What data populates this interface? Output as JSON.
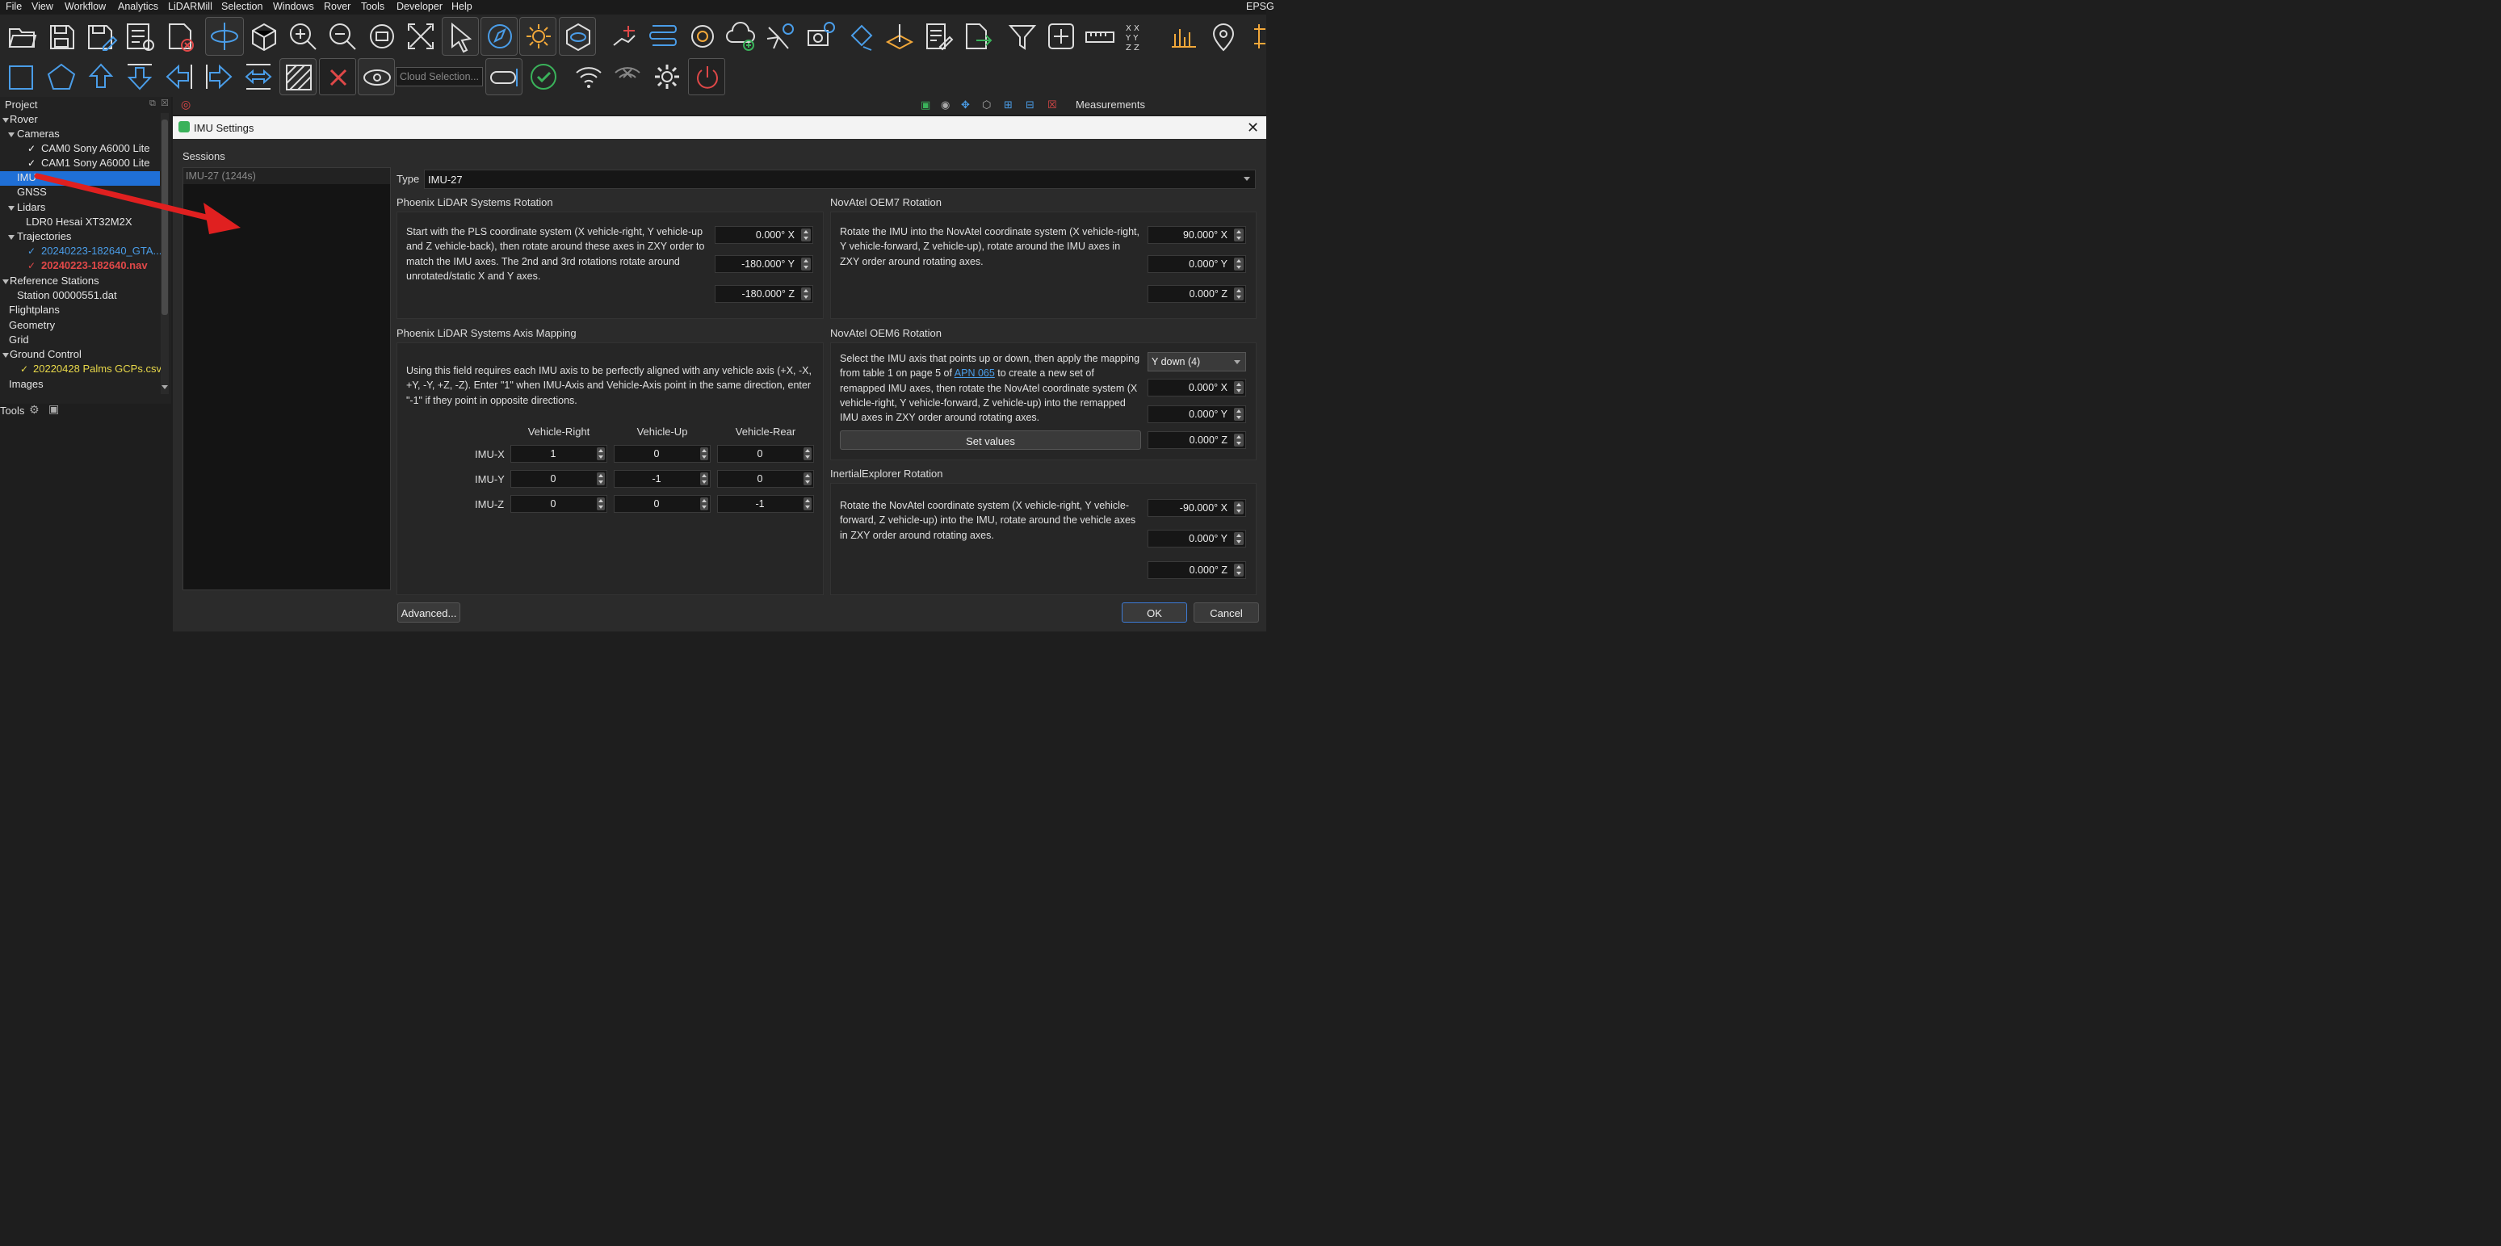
{
  "menu": [
    "File",
    "View",
    "Workflow",
    "Analytics",
    "LiDARMill",
    "Selection",
    "Windows",
    "Rover",
    "Tools",
    "Developer",
    "Help"
  ],
  "menu_right": "EPSG",
  "toolbar2": {
    "cloud_selection_placeholder": "Cloud Selection..."
  },
  "project": {
    "title": "Project",
    "tree": {
      "rover": "Rover",
      "cameras": "Cameras",
      "cam0": "CAM0 Sony A6000 Lite",
      "cam1": "CAM1 Sony A6000 Lite",
      "imu": "IMU",
      "gnss": "GNSS",
      "lidars": "Lidars",
      "ldr0": "LDR0 Hesai XT32M2X",
      "trajectories": "Trajectories",
      "traj1": "20240223-182640_GTA...",
      "traj2": "20240223-182640.nav",
      "reference_stations": "Reference Stations",
      "station": "Station 00000551.dat",
      "flightplans": "Flightplans",
      "geometry": "Geometry",
      "grid": "Grid",
      "ground_control": "Ground Control",
      "gcp": "20220428 Palms GCPs.csv",
      "images": "Images"
    },
    "tools_label": "Tools"
  },
  "measurements_label": "Measurements",
  "dialog": {
    "title": "IMU Settings",
    "sessions_label": "Sessions",
    "session_item": "IMU-27 (1244s)",
    "type_label": "Type",
    "type_value": "IMU-27",
    "pls_rotation": {
      "title": "Phoenix LiDAR Systems Rotation",
      "description": "Start with the PLS coordinate system (X vehicle-right, Y vehicle-up and Z vehicle-back), then rotate around these axes in ZXY order to match the IMU axes. The 2nd and 3rd rotations rotate around unrotated/static X and Y axes.",
      "x": "0.000° X",
      "y": "-180.000° Y",
      "z": "-180.000° Z"
    },
    "oem7_rotation": {
      "title": "NovAtel OEM7 Rotation",
      "description": "Rotate the IMU into the NovAtel coordinate system (X vehicle-right, Y vehicle-forward, Z vehicle-up), rotate around the IMU axes in ZXY order around rotating axes.",
      "x": "90.000° X",
      "y": "0.000° Y",
      "z": "0.000° Z"
    },
    "axis_mapping": {
      "title": "Phoenix LiDAR Systems Axis Mapping",
      "description": "Using this field requires each IMU axis to be perfectly aligned with any vehicle axis (+X, -X, +Y, -Y, +Z, -Z). Enter \"1\" when IMU-Axis and Vehicle-Axis point in the same direction, enter \"-1\" if they point in opposite directions.",
      "columns": [
        "Vehicle-Right",
        "Vehicle-Up",
        "Vehicle-Rear"
      ],
      "rows": [
        {
          "label": "IMU-X",
          "values": [
            "1",
            "0",
            "0"
          ]
        },
        {
          "label": "IMU-Y",
          "values": [
            "0",
            "-1",
            "0"
          ]
        },
        {
          "label": "IMU-Z",
          "values": [
            "0",
            "0",
            "-1"
          ]
        }
      ]
    },
    "oem6_rotation": {
      "title": "NovAtel OEM6 Rotation",
      "desc_part1": "Select the IMU axis that points up or down, then apply the mapping from table 1 on page 5 of ",
      "link": "APN 065",
      "desc_part2": " to create a new set of remapped IMU axes, then rotate the NovAtel coordinate system (X vehicle-right, Y vehicle-forward, Z vehicle-up) into the remapped IMU axes in ZXY order around rotating axes.",
      "axis_select": "Y down (4)",
      "set_values": "Set values",
      "x": "0.000° X",
      "y": "0.000° Y",
      "z": "0.000° Z"
    },
    "ie_rotation": {
      "title": "InertialExplorer Rotation",
      "description": "Rotate the NovAtel coordinate system (X vehicle-right, Y vehicle-forward, Z vehicle-up) into the IMU, rotate around the vehicle axes in ZXY order around rotating axes.",
      "x": "-90.000° X",
      "y": "0.000° Y",
      "z": "0.000° Z"
    },
    "advanced": "Advanced...",
    "ok": "OK",
    "cancel": "Cancel"
  }
}
